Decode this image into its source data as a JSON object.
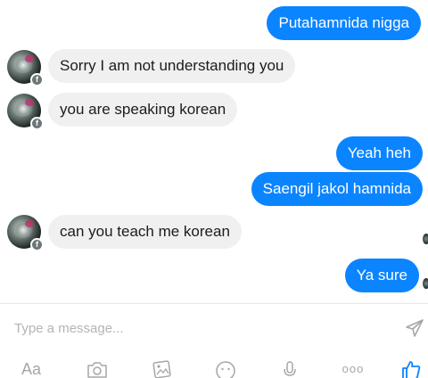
{
  "messages": [
    {
      "side": "out",
      "text": "Putahamnida nigga"
    },
    {
      "side": "in",
      "text": "Sorry I am not understanding you"
    },
    {
      "side": "in",
      "text": "you are speaking korean"
    },
    {
      "side": "out",
      "text": "Yeah heh"
    },
    {
      "side": "out",
      "text": "Saengil jakol hamnida"
    },
    {
      "side": "in",
      "text": "can you teach me korean"
    },
    {
      "side": "out",
      "text": "Ya sure"
    }
  ],
  "composer": {
    "placeholder": "Type a message...",
    "text_tool_label": "Aa",
    "more_label": "ooo"
  },
  "colors": {
    "outgoing_bubble": "#0b84ff",
    "incoming_bubble": "#f1f0f0",
    "icon_gray": "#a6a6a6",
    "like_blue": "#0b84ff"
  },
  "icons": [
    "send-icon",
    "text-format-icon",
    "camera-icon",
    "gallery-icon",
    "emoji-icon",
    "microphone-icon",
    "more-icon",
    "thumbs-up-icon"
  ]
}
